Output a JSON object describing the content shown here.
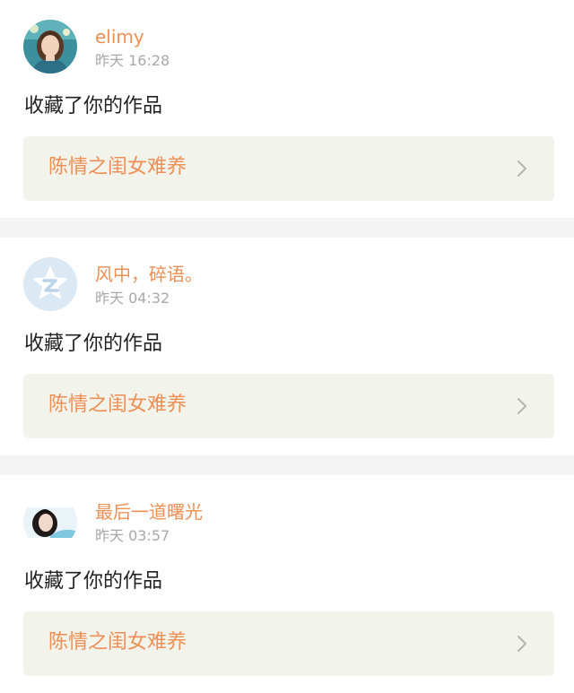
{
  "notifications": [
    {
      "username": "elimy",
      "time": "昨天 16:28",
      "action": "收藏了你的作品",
      "work_title": "陈情之闺女难养",
      "avatar_icon": "photo-avatar-girl"
    },
    {
      "username": "风中，碎语。",
      "time": "昨天 04:32",
      "action": "收藏了你的作品",
      "work_title": "陈情之闺女难养",
      "avatar_icon": "default-star-z-avatar"
    },
    {
      "username": "最后一道曙光",
      "time": "昨天 03:57",
      "action": "收藏了你的作品",
      "work_title": "陈情之闺女难养",
      "avatar_icon": "photo-avatar-woman"
    }
  ],
  "colors": {
    "accent": "#ee8f55",
    "work_box_bg": "#f2f3ea",
    "time_text": "#a8a8a8",
    "separator": "#f4f4f4"
  }
}
